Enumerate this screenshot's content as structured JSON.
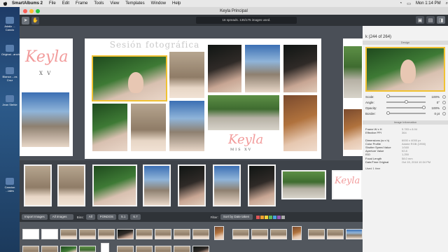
{
  "menubar": {
    "app_name": "SmartAlbums 2",
    "items": [
      "File",
      "Edit",
      "Frame",
      "Tools",
      "View",
      "Templates",
      "Window",
      "Help"
    ],
    "clock": "Mon 1:14 PM"
  },
  "desktop": {
    "items": [
      {
        "label": "Adaliz ... Cancio"
      },
      {
        "label": "Original...anchez"
      },
      {
        "label": "Blanca ...os Cruz"
      },
      {
        "label": "Jean Stehle"
      },
      {
        "label": "Cancion ...iales"
      }
    ]
  },
  "window": {
    "title": "Keyla Principal",
    "status_text": "16 spreads. 135/175 images used."
  },
  "spread": {
    "title": "Sesión fotográfica",
    "logo_text": "Keyla",
    "logo_sub": "MIS XV",
    "left_logo_text": "Keyla",
    "left_logo_sub": "X V"
  },
  "browser": {
    "import_label": "Import Images",
    "filter_select": "All images",
    "bins_label": "Bins:",
    "bins": [
      "All",
      "FONDOS",
      "5.1",
      "6.7"
    ],
    "filter_label": "Filter:",
    "sort_select": "Sort by Date taken",
    "colors": [
      "#e05555",
      "#f0a030",
      "#f2d23a",
      "#5cb85c",
      "#4aa0e0",
      "#9b59b6",
      "#aaaaaa"
    ]
  },
  "inspector": {
    "header": "k (244 of 264)",
    "design_section": "Design",
    "controls": [
      {
        "label": "Scale:",
        "value": "100%"
      },
      {
        "label": "Angle:",
        "value": "0°"
      },
      {
        "label": "Opacity:",
        "value": "100%"
      },
      {
        "label": "Border:",
        "value": "0 pt"
      }
    ],
    "info_section": "Image Information",
    "info": [
      {
        "key": "Frame W x H",
        "value": "5.783 x 8.04"
      },
      {
        "key": "Effective PPI",
        "value": "364"
      },
      {
        "key": "",
        "value": ""
      },
      {
        "key": "Dimensions (w x h)",
        "value": "6000 x 4000 px"
      },
      {
        "key": "Color Profile",
        "value": "Adobe RGB (1998)"
      },
      {
        "key": "Shutter Speed Value",
        "value": "1/160"
      },
      {
        "key": "Aperture Value",
        "value": "f/2.8"
      },
      {
        "key": "ISO",
        "value": "1,250"
      },
      {
        "key": "Focal Length",
        "value": "58.0 mm"
      },
      {
        "key": "Date/Time Original",
        "value": "Oct 15, 2018 10:34 PM"
      }
    ],
    "used_text": "Used 1 time"
  },
  "icons": {
    "apple": "apple-icon",
    "arrow": "pointer-tool-icon",
    "hand": "hand-tool-icon"
  }
}
